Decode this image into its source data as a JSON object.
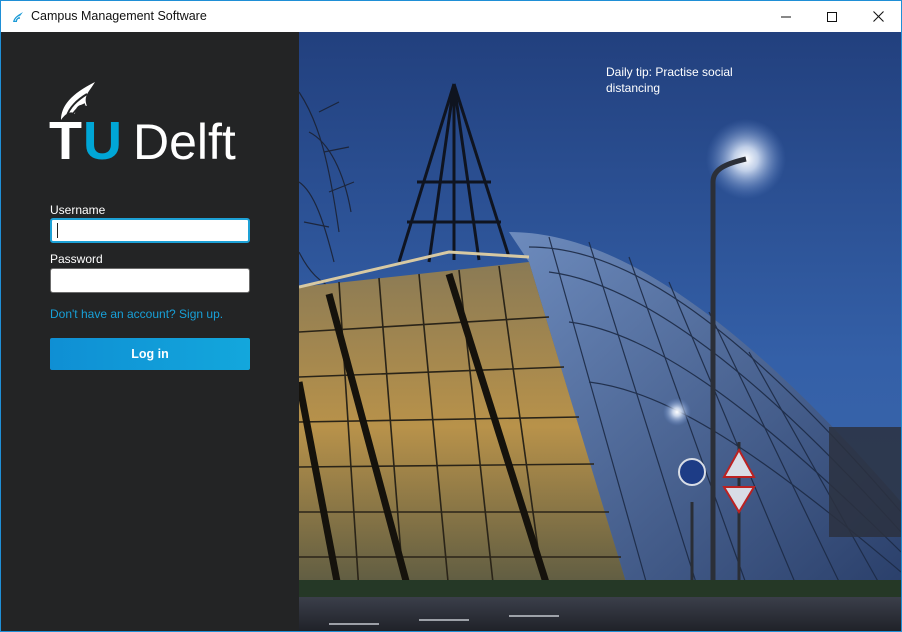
{
  "window": {
    "title": "Campus Management Software",
    "accent_color": "#1f8fd6"
  },
  "titlebar_buttons": {
    "minimize_icon": "minimize-icon",
    "maximize_icon": "maximize-icon",
    "close_icon": "close-icon"
  },
  "logo": {
    "text_t": "T",
    "text_u": "U",
    "text_delft": "Delft",
    "brand_cyan": "#00a6d6"
  },
  "login": {
    "username_label": "Username",
    "username_value": "",
    "password_label": "Password",
    "password_value": "",
    "signup_text": "Don't have an account? Sign up.",
    "login_button": "Log in",
    "panel_color": "#232425",
    "link_color": "#18a0d8"
  },
  "photo": {
    "daily_tip": "Daily tip: Practise social distancing"
  }
}
